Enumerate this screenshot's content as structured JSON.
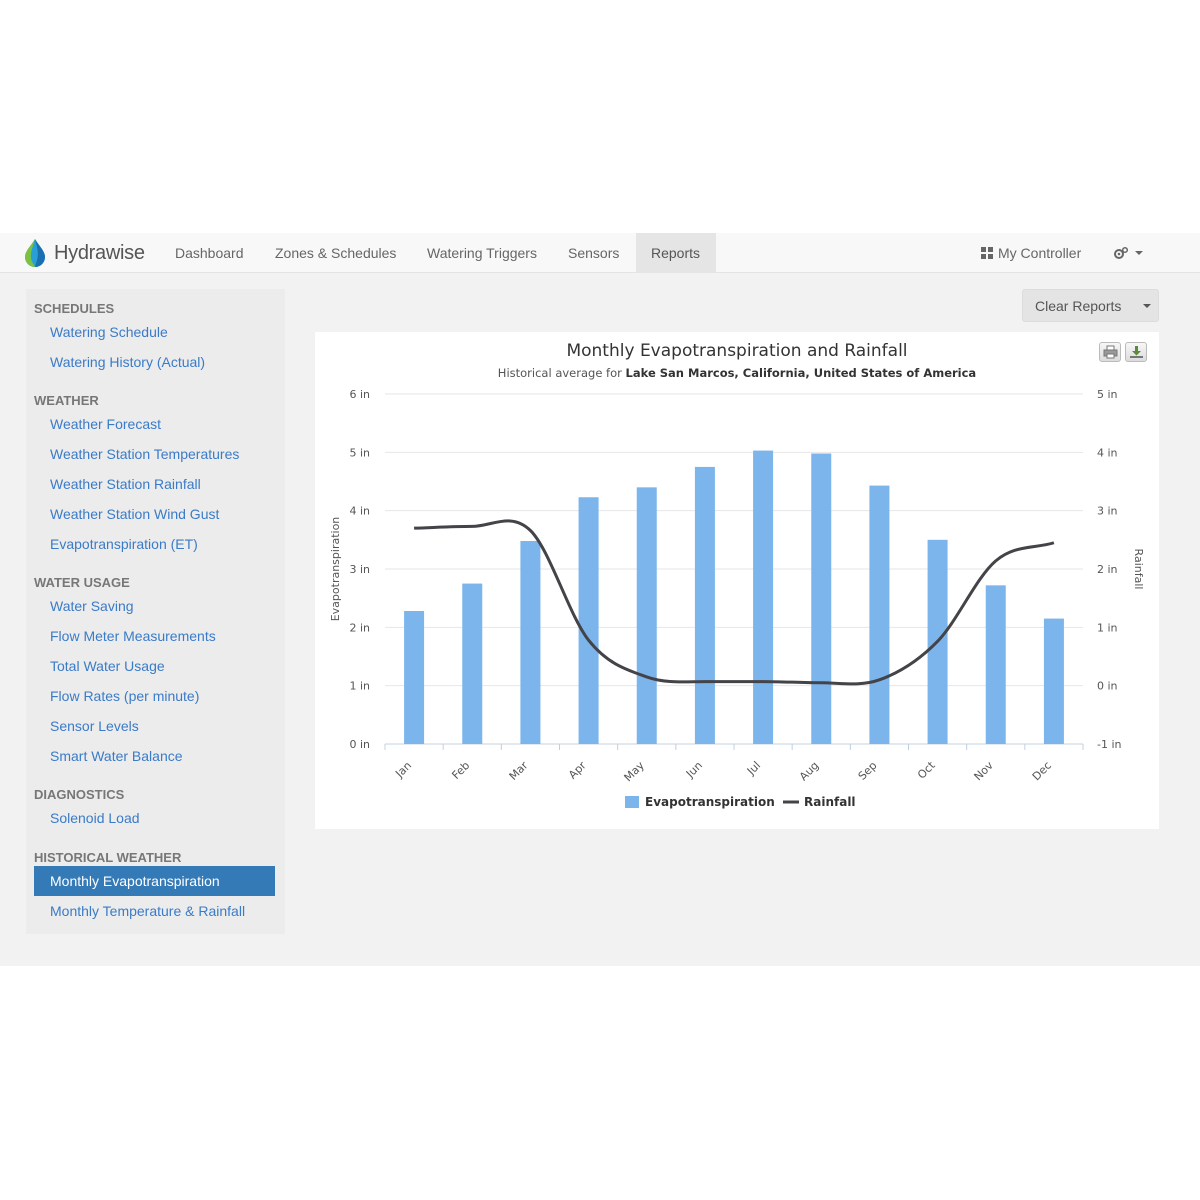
{
  "nav": {
    "brand": "Hydrawise",
    "items": [
      {
        "label": "Dashboard",
        "name": "nav-dashboard",
        "active": false
      },
      {
        "label": "Zones & Schedules",
        "name": "nav-zones-schedules",
        "active": false
      },
      {
        "label": "Watering Triggers",
        "name": "nav-watering-triggers",
        "active": false
      },
      {
        "label": "Sensors",
        "name": "nav-sensors",
        "active": false
      },
      {
        "label": "Reports",
        "name": "nav-reports",
        "active": true
      }
    ],
    "my_controller": "My Controller"
  },
  "sidebar": {
    "sections": [
      {
        "heading": "SCHEDULES",
        "items": [
          "Watering Schedule",
          "Watering History (Actual)"
        ]
      },
      {
        "heading": "WEATHER",
        "items": [
          "Weather Forecast",
          "Weather Station Temperatures",
          "Weather Station Rainfall",
          "Weather Station Wind Gust",
          "Evapotranspiration (ET)"
        ]
      },
      {
        "heading": "WATER USAGE",
        "items": [
          "Water Saving",
          "Flow Meter Measurements",
          "Total Water Usage",
          "Flow Rates (per minute)",
          "Sensor Levels",
          "Smart Water Balance"
        ]
      },
      {
        "heading": "DIAGNOSTICS",
        "items": [
          "Solenoid Load"
        ]
      },
      {
        "heading": "HISTORICAL WEATHER",
        "items": [
          "Monthly Evapotranspiration",
          "Monthly Temperature & Rainfall"
        ]
      }
    ],
    "active_item": "Monthly Evapotranspiration"
  },
  "toolbar": {
    "clear_reports": "Clear Reports"
  },
  "colors": {
    "bar": "#7cb5ec",
    "line": "#434348",
    "link": "#3a7bc8",
    "active": "#337ab7"
  },
  "chart_data": {
    "type": "bar+line",
    "title": "Monthly Evapotranspiration and Rainfall",
    "subtitle_prefix": "Historical average for ",
    "subtitle_location": "Lake San Marcos, California, United States of America",
    "categories": [
      "Jan",
      "Feb",
      "Mar",
      "Apr",
      "May",
      "Jun",
      "Jul",
      "Aug",
      "Sep",
      "Oct",
      "Nov",
      "Dec"
    ],
    "series": [
      {
        "name": "Evapotranspiration",
        "type": "bar",
        "axis": "left",
        "values": [
          2.28,
          2.75,
          3.48,
          4.23,
          4.4,
          4.75,
          5.03,
          4.98,
          4.43,
          3.5,
          2.72,
          2.15
        ]
      },
      {
        "name": "Rainfall",
        "type": "line",
        "axis": "right",
        "values": [
          2.7,
          2.73,
          2.66,
          0.78,
          0.15,
          0.07,
          0.07,
          0.05,
          0.1,
          0.76,
          2.14,
          2.45
        ]
      }
    ],
    "y_left": {
      "label": "Evapotranspiration",
      "min": 0,
      "max": 6,
      "ticks": [
        "0 in",
        "1 in",
        "2 in",
        "3 in",
        "4 in",
        "5 in",
        "6 in"
      ]
    },
    "y_right": {
      "label": "Rainfall",
      "min": -1,
      "max": 5,
      "ticks": [
        "-1 in",
        "0 in",
        "1 in",
        "2 in",
        "3 in",
        "4 in",
        "5 in"
      ]
    },
    "grid": true,
    "legend": "bottom-center"
  }
}
